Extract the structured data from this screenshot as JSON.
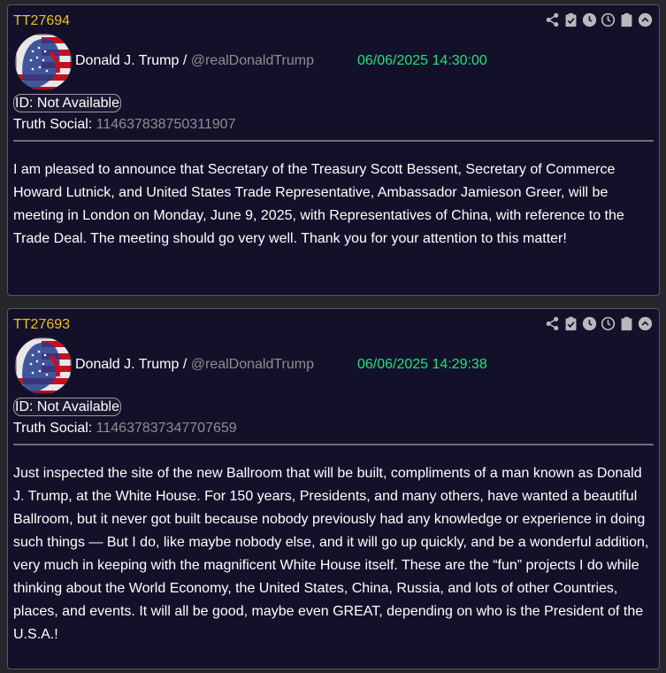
{
  "posts": [
    {
      "id": "TT27694",
      "author": "Donald J. Trump",
      "separator": "/",
      "handle": "@realDonaldTrump",
      "timestamp": "06/06/2025 14:30:00",
      "id_label": "ID: Not Available",
      "source_label": "Truth Social:",
      "source_id": "114637838750311907",
      "text": "I am pleased to announce that Secretary of the Treasury Scott Bessent, Secretary of Commerce Howard Lutnick, and United States Trade Representative, Ambassador Jamieson Greer, will be meeting in London on Monday, June 9, 2025, with Representatives of China, with reference to the Trade Deal. The meeting should go very well. Thank you for your attention to this matter!"
    },
    {
      "id": "TT27693",
      "author": "Donald J. Trump",
      "separator": "/",
      "handle": "@realDonaldTrump",
      "timestamp": "06/06/2025 14:29:38",
      "id_label": "ID: Not Available",
      "source_label": "Truth Social:",
      "source_id": "114637837347707659",
      "text": "Just inspected the site of the new Ballroom that will be built, compliments of a man known as Donald J. Trump, at the White House. For 150 years, Presidents, and many others, have wanted a beautiful Ballroom, but it never got built because nobody previously had any knowledge or experience in doing such things — But I do, like maybe nobody else, and it will go up quickly, and be a wonderful addition, very much in keeping with the magnificent White House itself. These are the “fun” projects I do while thinking about the World Economy, the United States, China, Russia, and lots of other Countries, places, and events. It will all be good, maybe even GREAT, depending on who is the President of the U.S.A.!"
    }
  ],
  "toolbar_icons": [
    "share-icon",
    "clipboard-check-icon",
    "clock-icon",
    "clock-outline-icon",
    "clipboard-icon",
    "chevron-up-circle-icon"
  ],
  "colors": {
    "background": "#26272d",
    "card": "#13112a",
    "post_id": "#f2be1f",
    "timestamp": "#22e07a",
    "muted": "#8d8d94",
    "text": "#ffffff"
  }
}
